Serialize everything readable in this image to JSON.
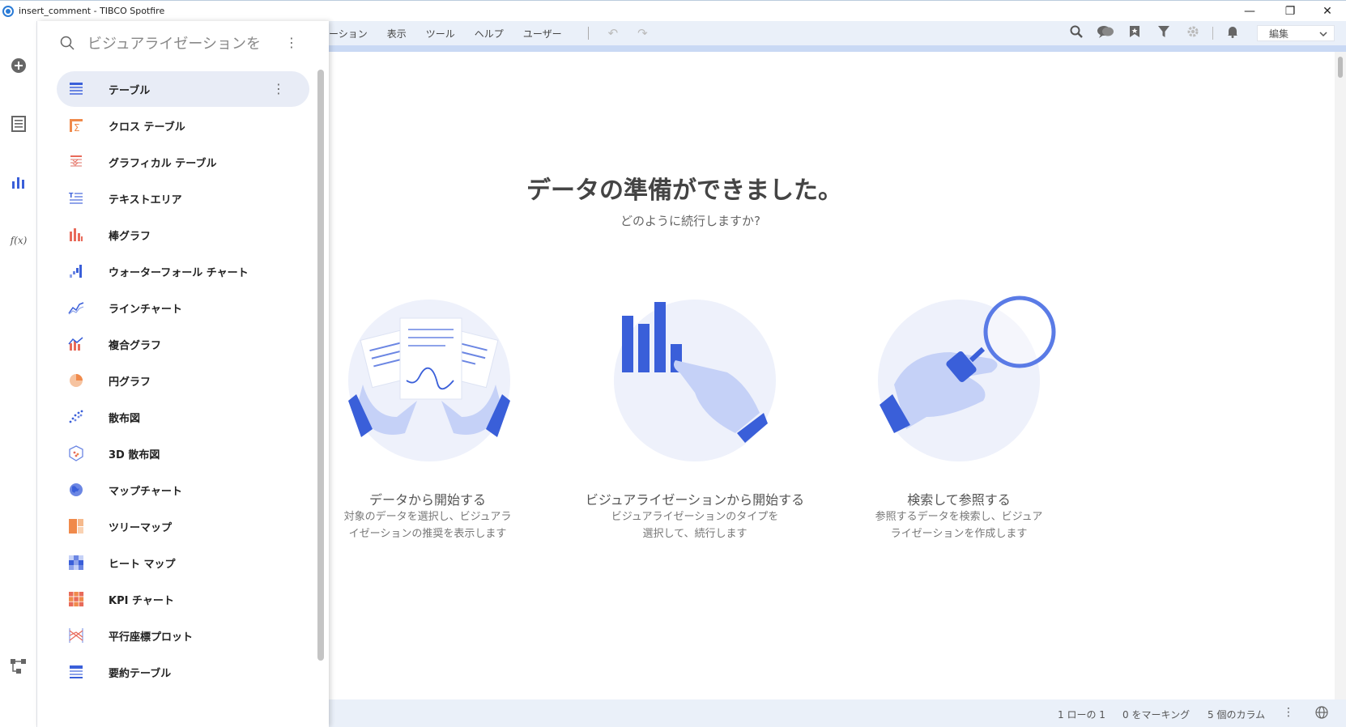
{
  "window": {
    "title": "insert_comment - TIBCO Spotfire",
    "minimize_glyph": "—",
    "restore_glyph": "❐",
    "close_glyph": "✕"
  },
  "rail": {
    "items": [
      {
        "name": "add-icon"
      },
      {
        "name": "data-table-icon"
      },
      {
        "name": "visualization-icon"
      },
      {
        "name": "function-icon",
        "glyph": "f(x)"
      },
      {
        "name": "flow-icon"
      }
    ]
  },
  "menubar": {
    "items": [
      "ーション",
      "表示",
      "ツール",
      "ヘルプ",
      "ユーザー"
    ],
    "undo_glyph": "↶",
    "redo_glyph": "↷",
    "edit_mode": "編集"
  },
  "panel": {
    "search_placeholder": "ビジュアライゼーションを",
    "items": [
      {
        "label": "テーブル",
        "icon": "table-icon"
      },
      {
        "label": "クロス テーブル",
        "icon": "cross-table-icon"
      },
      {
        "label": "グラフィカル テーブル",
        "icon": "graphical-table-icon"
      },
      {
        "label": "テキストエリア",
        "icon": "text-area-icon"
      },
      {
        "label": "棒グラフ",
        "icon": "bar-chart-icon"
      },
      {
        "label": "ウォーターフォール チャート",
        "icon": "waterfall-chart-icon"
      },
      {
        "label": "ラインチャート",
        "icon": "line-chart-icon"
      },
      {
        "label": "複合グラフ",
        "icon": "combination-chart-icon"
      },
      {
        "label": "円グラフ",
        "icon": "pie-chart-icon"
      },
      {
        "label": "散布図",
        "icon": "scatter-plot-icon"
      },
      {
        "label": "3D 散布図",
        "icon": "3d-scatter-plot-icon"
      },
      {
        "label": "マップチャート",
        "icon": "map-chart-icon"
      },
      {
        "label": "ツリーマップ",
        "icon": "treemap-icon"
      },
      {
        "label": "ヒート マップ",
        "icon": "heat-map-icon"
      },
      {
        "label": "KPI チャート",
        "icon": "kpi-chart-icon"
      },
      {
        "label": "平行座標プロット",
        "icon": "parallel-coordinate-icon"
      },
      {
        "label": "要約テーブル",
        "icon": "summary-table-icon"
      }
    ]
  },
  "main": {
    "headline": "データの準備ができました。",
    "subheadline": "どのように続行しますか?",
    "options": [
      {
        "title": "データから開始する",
        "desc_line1": "対象のデータを選択し、ビジュアラ",
        "desc_line2": "イゼーションの推奨を表示します"
      },
      {
        "title": "ビジュアライゼーションから開始する",
        "desc_line1": "ビジュアライゼーションのタイプを",
        "desc_line2": "選択して、続行します"
      },
      {
        "title": "検索して参照する",
        "desc_line1": "参照するデータを検索し、ビジュア",
        "desc_line2": "ライゼーションを作成します"
      }
    ]
  },
  "status": {
    "rows": "1 ローの 1",
    "marked": "0 をマーキング",
    "columns": "5 個のカラム"
  },
  "colors": {
    "accent": "#3a5fd9",
    "accent_light": "#c9d6fb",
    "menubar_bg": "#eaf0f9",
    "orange": "#f08a4b"
  }
}
